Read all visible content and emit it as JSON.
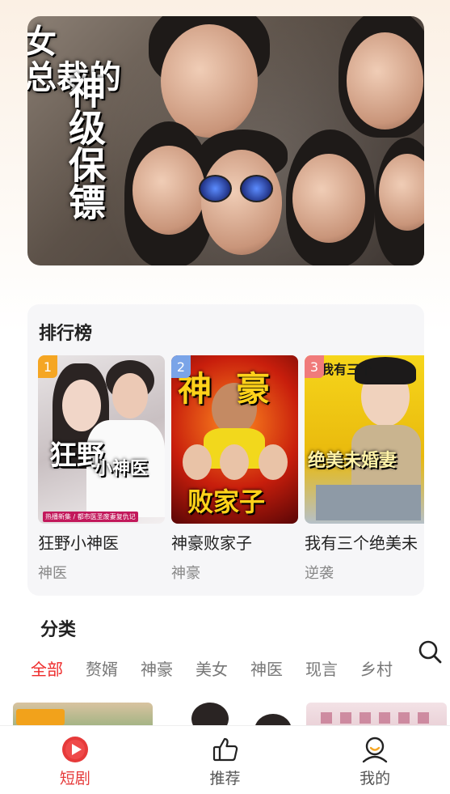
{
  "banner": {
    "title_col1": "总裁的",
    "title_col2": "神级保镖",
    "title_top": "女"
  },
  "ranking": {
    "title": "排行榜",
    "items": [
      {
        "rank": "1",
        "name": "狂野小神医",
        "tag": "神医",
        "poster_text": "狂野",
        "poster_text2": "小神医",
        "poster_caption": "热播新集 / 都市医圣废妻复仇记",
        "badge_color": "#f5a623"
      },
      {
        "rank": "2",
        "name": "神豪败家子",
        "tag": "神豪",
        "poster_text": "神豪",
        "poster_text2": "败家子",
        "badge_color": "#7aa4e8"
      },
      {
        "rank": "3",
        "name": "我有三个绝美未",
        "tag": "逆袭",
        "poster_text": "我有三个",
        "poster_text2": "绝美未婚妻",
        "badge_color": "#f07b7b"
      }
    ]
  },
  "category": {
    "title": "分类",
    "tabs": [
      "全部",
      "赘婿",
      "神豪",
      "美女",
      "神医",
      "现言",
      "乡村"
    ],
    "active_index": 0
  },
  "tabbar": {
    "items": [
      {
        "label": "短剧",
        "icon": "play-circle-icon",
        "active": true
      },
      {
        "label": "推荐",
        "icon": "thumbs-up-icon",
        "active": false
      },
      {
        "label": "我的",
        "icon": "user-icon",
        "active": false
      }
    ]
  },
  "colors": {
    "accent": "#e63a3a",
    "rank1": "#f5a623",
    "rank2": "#7aa4e8",
    "rank3": "#f07b7b"
  }
}
